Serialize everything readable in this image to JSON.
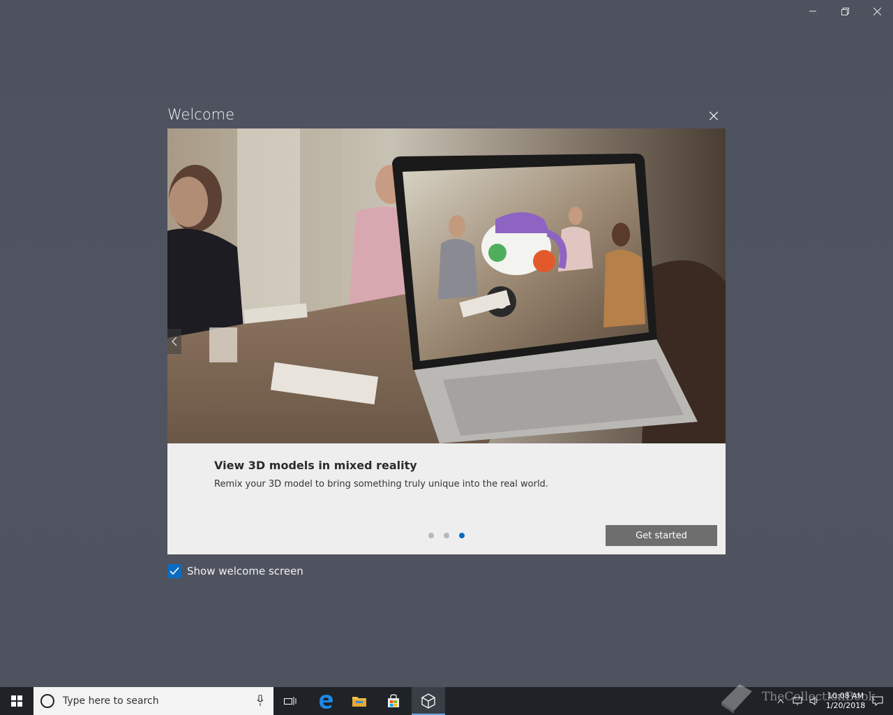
{
  "window": {
    "controls": [
      "minimize",
      "restore",
      "close"
    ]
  },
  "dialog": {
    "title": "Welcome",
    "slide": {
      "heading": "View 3D models in mixed reality",
      "description": "Remix your 3D model to bring something truly unique into the real world.",
      "current_index": 3,
      "total": 3
    },
    "primary_button_label": "Get started",
    "checkbox": {
      "label": "Show welcome screen",
      "checked": true
    }
  },
  "taskbar": {
    "search_placeholder": "Type here to search",
    "pinned_icons": [
      "task-view-icon",
      "edge-icon",
      "file-explorer-icon",
      "store-icon",
      "mixed-reality-viewer-icon"
    ],
    "active_app": "mixed-reality-viewer-icon",
    "clock_time": "10:08 AM",
    "clock_date": "1/20/2018"
  },
  "watermark": {
    "text": "TheCollectionBook"
  },
  "colors": {
    "accent": "#0a6cc2",
    "background": "#4e525e",
    "button": "#6e6e6e",
    "taskbar": "#1f2328"
  }
}
